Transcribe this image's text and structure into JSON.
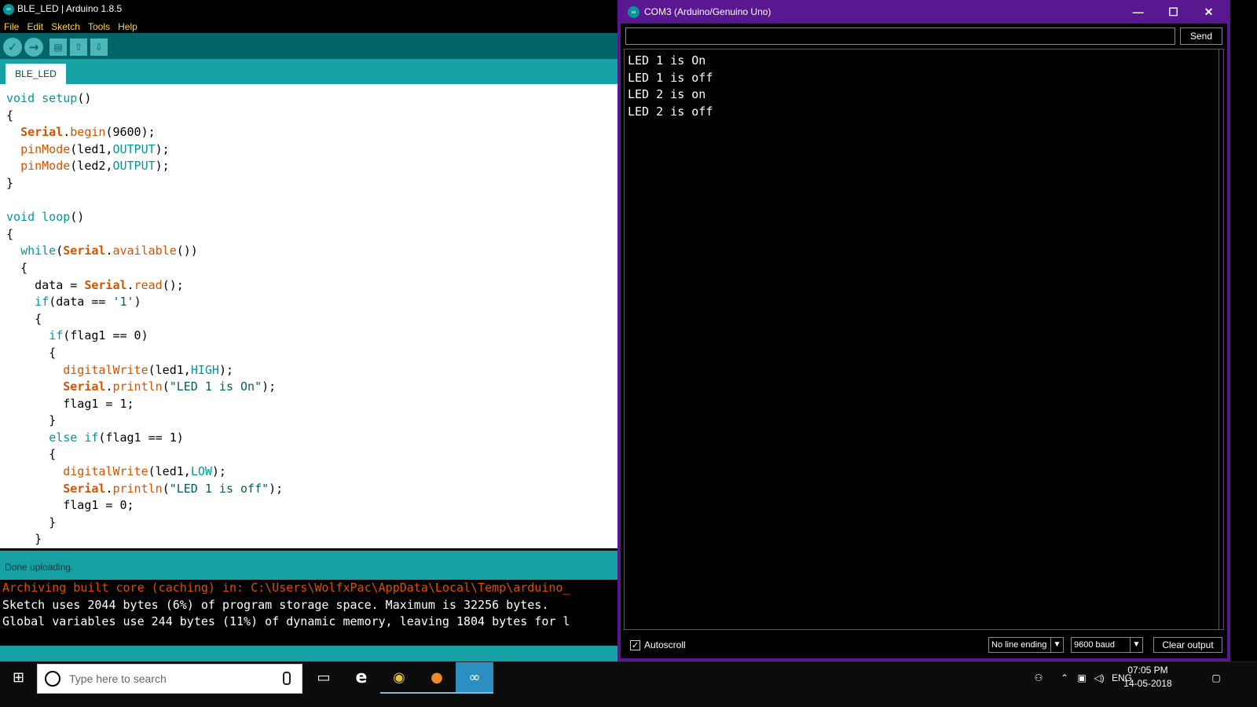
{
  "ide": {
    "title": "BLE_LED | Arduino 1.8.5",
    "logo_glyph": "∞",
    "menu": [
      "File",
      "Edit",
      "Sketch",
      "Tools",
      "Help"
    ],
    "toolbar": {
      "verify_icon": "check-icon",
      "upload_icon": "arrow-right-icon",
      "new_icon": "document-icon",
      "open_icon": "arrow-up-icon",
      "save_icon": "arrow-down-icon"
    },
    "tab": "BLE_LED",
    "status": "Done uploading.",
    "console": [
      "Archiving built core (caching) in: C:\\Users\\WolfxPac\\AppData\\Local\\Temp\\arduino_",
      "Sketch uses 2044 bytes (6%) of program storage space. Maximum is 32256 bytes.",
      "Global variables use 244 bytes (11%) of dynamic memory, leaving 1804 bytes for l"
    ],
    "code_lines": [
      "void setup()",
      "{",
      "  Serial.begin(9600);",
      "  pinMode(led1,OUTPUT);",
      "  pinMode(led2,OUTPUT);",
      "}",
      "",
      "void loop()",
      "{",
      "  while(Serial.available())",
      "  {",
      "    data = Serial.read();",
      "    if(data == '1')",
      "    {",
      "      if(flag1 == 0)",
      "      {",
      "        digitalWrite(led1,HIGH);",
      "        Serial.println(\"LED 1 is On\");",
      "        flag1 = 1;",
      "      }",
      "      else if(flag1 == 1)",
      "      {",
      "        digitalWrite(led1,LOW);",
      "        Serial.println(\"LED 1 is off\");",
      "        flag1 = 0;",
      "      }",
      "    }"
    ]
  },
  "serial": {
    "title": "COM3 (Arduino/Genuino Uno)",
    "input_value": "",
    "send_label": "Send",
    "output": [
      "LED 1 is On",
      "LED 1 is off",
      "LED 2 is on",
      "LED 2 is off"
    ],
    "autoscroll_label": "Autoscroll",
    "autoscroll_checked": true,
    "line_ending": "No line ending",
    "baud": "9600 baud",
    "clear_label": "Clear output",
    "window_buttons": {
      "minimize": "—",
      "maximize": "☐",
      "close": "✕"
    }
  },
  "taskbar": {
    "search_placeholder": "Type here to search",
    "apps": [
      "task-view-icon",
      "edge-icon",
      "chrome-icon",
      "firefox-icon",
      "arduino-icon"
    ],
    "language": "ENG",
    "time": "07:05 PM",
    "date": "14-05-2018"
  },
  "colors": {
    "ide_teal": "#17a1a5",
    "ide_toolbar": "#006468",
    "keyword": "#00979c",
    "function": "#d35400",
    "serial_frame": "#5a1890",
    "menu_text": "#ffd23d"
  }
}
